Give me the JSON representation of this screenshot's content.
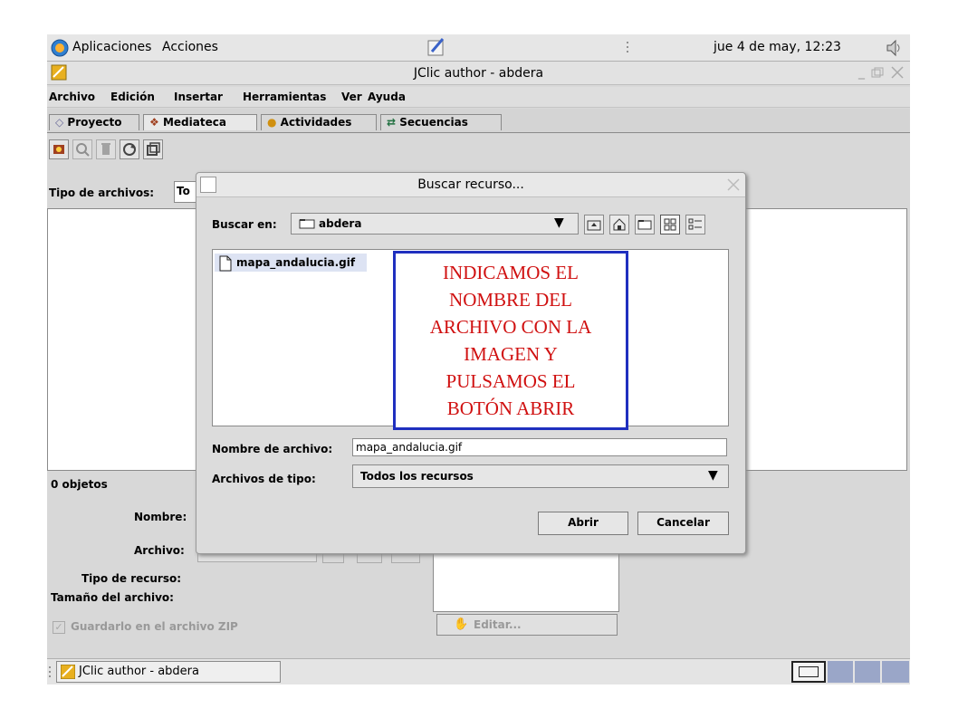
{
  "top_panel": {
    "applications": "Aplicaciones",
    "actions": "Acciones",
    "clock": "jue  4 de may, 12:23"
  },
  "window": {
    "title": "JClic author - abdera"
  },
  "menu": [
    "Archivo",
    "Edición",
    "Insertar",
    "Herramientas",
    "Ver",
    "Ayuda"
  ],
  "tabs": [
    "Proyecto",
    "Mediateca",
    "Actividades",
    "Secuencias"
  ],
  "active_tab": "Mediateca",
  "filter": {
    "label": "Tipo de archivos:",
    "value": "To"
  },
  "objects_count": "0 objetos",
  "fields": {
    "name_label": "Nombre:",
    "file_label": "Archivo:",
    "resource_type_label": "Tipo de recurso:",
    "file_size_label": "Tamaño del archivo:",
    "save_zip_label": "Guardarlo en el archivo ZIP",
    "edit_button": "Editar..."
  },
  "dialog": {
    "title": "Buscar recurso...",
    "look_in_label": "Buscar en:",
    "look_in_value": "abdera",
    "files": [
      "mapa_andalucia.gif"
    ],
    "filename_label": "Nombre de archivo:",
    "filename_value": "mapa_andalucia.gif",
    "filetype_label": "Archivos de tipo:",
    "filetype_value": "Todos los recursos",
    "open_button": "Abrir",
    "cancel_button": "Cancelar"
  },
  "annotation": [
    "INDICAMOS EL",
    "NOMBRE DEL",
    "ARCHIVO CON LA",
    "IMAGEN Y",
    "PULSAMOS EL",
    "BOTÓN ABRIR"
  ],
  "taskbar": {
    "item": "JClic author - abdera"
  },
  "colors": {
    "annotation_border": "#1f2fbf",
    "annotation_text": "#d01010"
  }
}
